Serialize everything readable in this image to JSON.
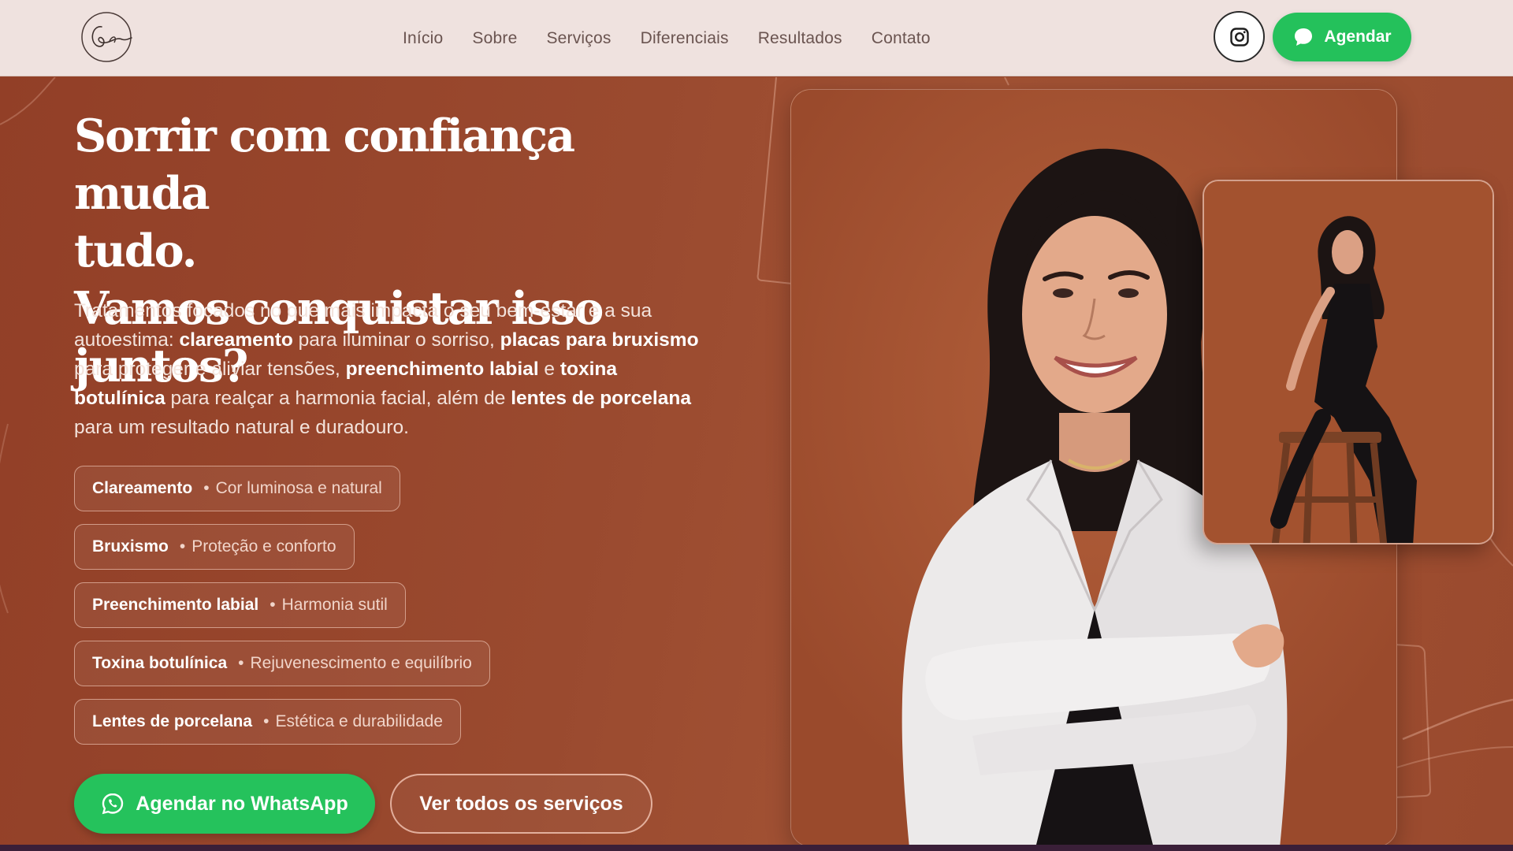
{
  "header": {
    "logo_icon": "signature-monogram-logo",
    "nav": [
      "Início",
      "Sobre",
      "Serviços",
      "Diferenciais",
      "Resultados",
      "Contato"
    ],
    "instagram_icon": "instagram-icon",
    "agendar_label": "Agendar",
    "agendar_icon": "chat-bubble-icon"
  },
  "hero": {
    "headline": [
      "Sorrir com confiança muda",
      "tudo.",
      "Vamos conquistar isso juntos?"
    ],
    "intro": [
      {
        "t": "Tratamentos focados no que mais impacta o seu bem-estar e a sua autoestima: ",
        "b": false
      },
      {
        "t": "clareamento",
        "b": true
      },
      {
        "t": " para iluminar o sorriso, ",
        "b": false
      },
      {
        "t": "placas para bruxismo",
        "b": true
      },
      {
        "t": " para proteger e aliviar tensões, ",
        "b": false
      },
      {
        "t": "preenchimento labial",
        "b": true
      },
      {
        "t": " e ",
        "b": false
      },
      {
        "t": "toxina botulínica",
        "b": true
      },
      {
        "t": " para realçar a harmonia facial, além de ",
        "b": false
      },
      {
        "t": "lentes de porcelana",
        "b": true
      },
      {
        "t": " para um resultado natural e duradouro.",
        "b": false
      }
    ],
    "services": [
      {
        "name": "Clareamento",
        "desc": "Cor luminosa e natural"
      },
      {
        "name": "Bruxismo",
        "desc": "Proteção e conforto"
      },
      {
        "name": "Preenchimento labial",
        "desc": "Harmonia sutil"
      },
      {
        "name": "Toxina botulínica",
        "desc": "Rejuvenescimento e equilíbrio"
      },
      {
        "name": "Lentes de porcelana",
        "desc": "Estética e durabilidade"
      }
    ],
    "service_separator": "•",
    "cta_whatsapp": "Agendar no WhatsApp",
    "cta_whatsapp_icon": "whatsapp-icon",
    "cta_services": "Ver todos os serviços"
  },
  "colors": {
    "header_bg": "#efe2df",
    "hero_bg": "#93442a",
    "whatsapp_green": "#25c25c",
    "headline_text": "#ffffff"
  }
}
